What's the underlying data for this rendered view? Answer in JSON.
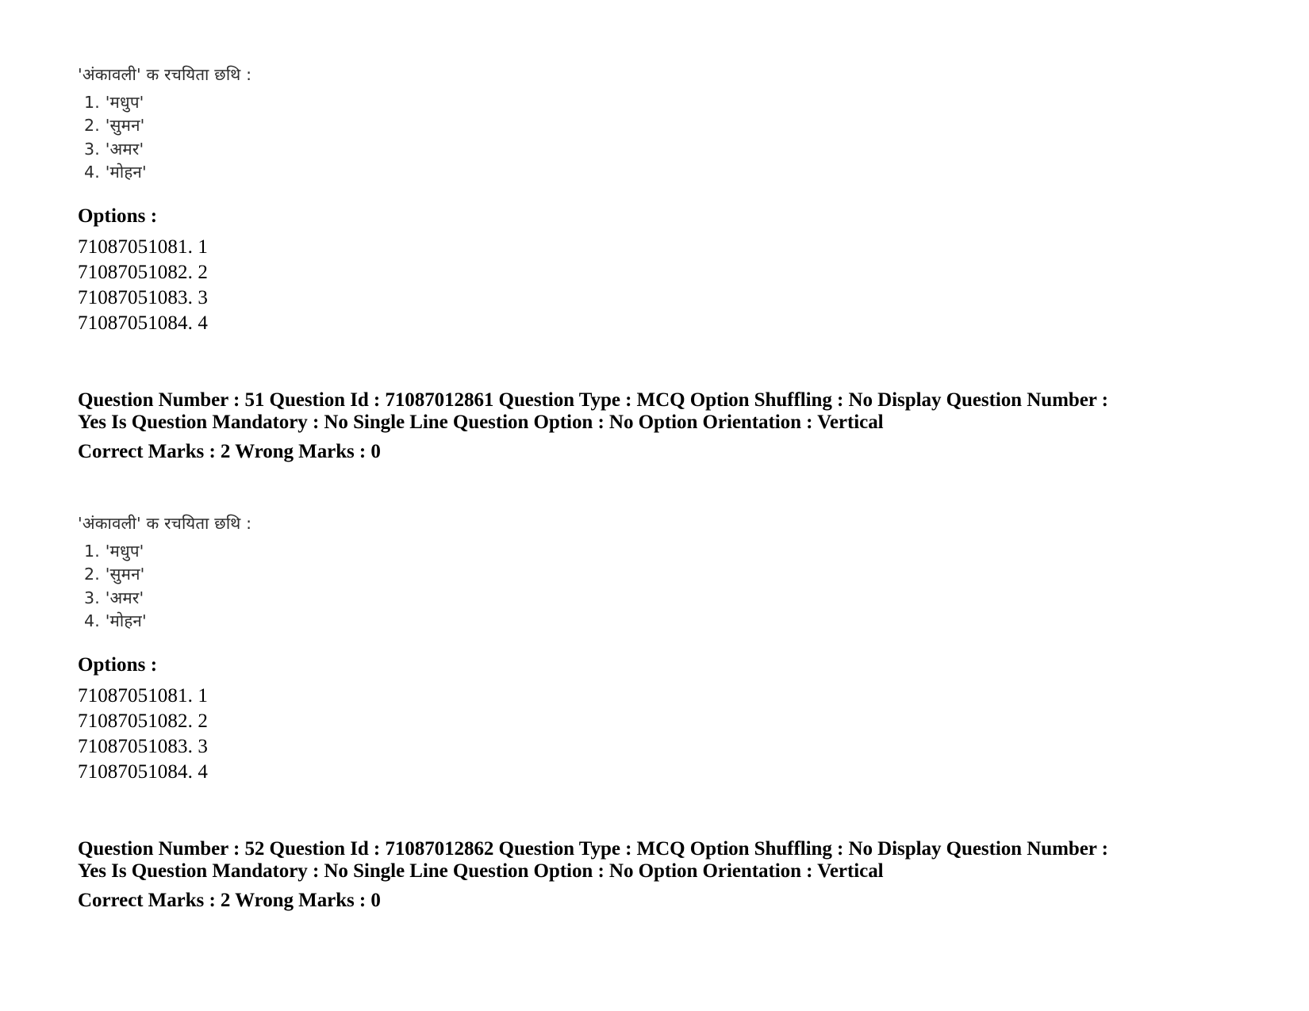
{
  "page": {
    "background_color": "#ffffff",
    "text_color": "#000000",
    "scan_text_color": "#2a2a2a"
  },
  "questions": [
    {
      "stem": "'अंकावली' क रचयिता छथि :",
      "choices": [
        {
          "num": "1.",
          "text": "'मधुप'"
        },
        {
          "num": "2.",
          "text": "'सुमन'"
        },
        {
          "num": "3.",
          "text": "'अमर'"
        },
        {
          "num": "4.",
          "text": "'मोहन'"
        }
      ],
      "options_heading": "Options :",
      "options": [
        {
          "id": "71087051081.",
          "label": "1"
        },
        {
          "id": "71087051082.",
          "label": "2"
        },
        {
          "id": "71087051083.",
          "label": "3"
        },
        {
          "id": "71087051084.",
          "label": "4"
        }
      ],
      "meta_line_1": "Question Number : 51 Question Id : 71087012861 Question Type : MCQ Option Shuffling : No Display Question Number : Yes Is Question Mandatory : No Single Line Question Option : No Option Orientation : Vertical",
      "meta_marks": "Correct Marks : 2 Wrong Marks : 0"
    },
    {
      "stem": "'अंकावली' क रचयिता छथि :",
      "choices": [
        {
          "num": "1.",
          "text": "'मधुप'"
        },
        {
          "num": "2.",
          "text": "'सुमन'"
        },
        {
          "num": "3.",
          "text": "'अमर'"
        },
        {
          "num": "4.",
          "text": "'मोहन'"
        }
      ],
      "options_heading": "Options :",
      "options": [
        {
          "id": "71087051081.",
          "label": "1"
        },
        {
          "id": "71087051082.",
          "label": "2"
        },
        {
          "id": "71087051083.",
          "label": "3"
        },
        {
          "id": "71087051084.",
          "label": "4"
        }
      ],
      "meta_line_1": "Question Number : 52 Question Id : 71087012862 Question Type : MCQ Option Shuffling : No Display Question Number : Yes Is Question Mandatory : No Single Line Question Option : No Option Orientation : Vertical",
      "meta_marks": "Correct Marks : 2 Wrong Marks : 0"
    }
  ]
}
